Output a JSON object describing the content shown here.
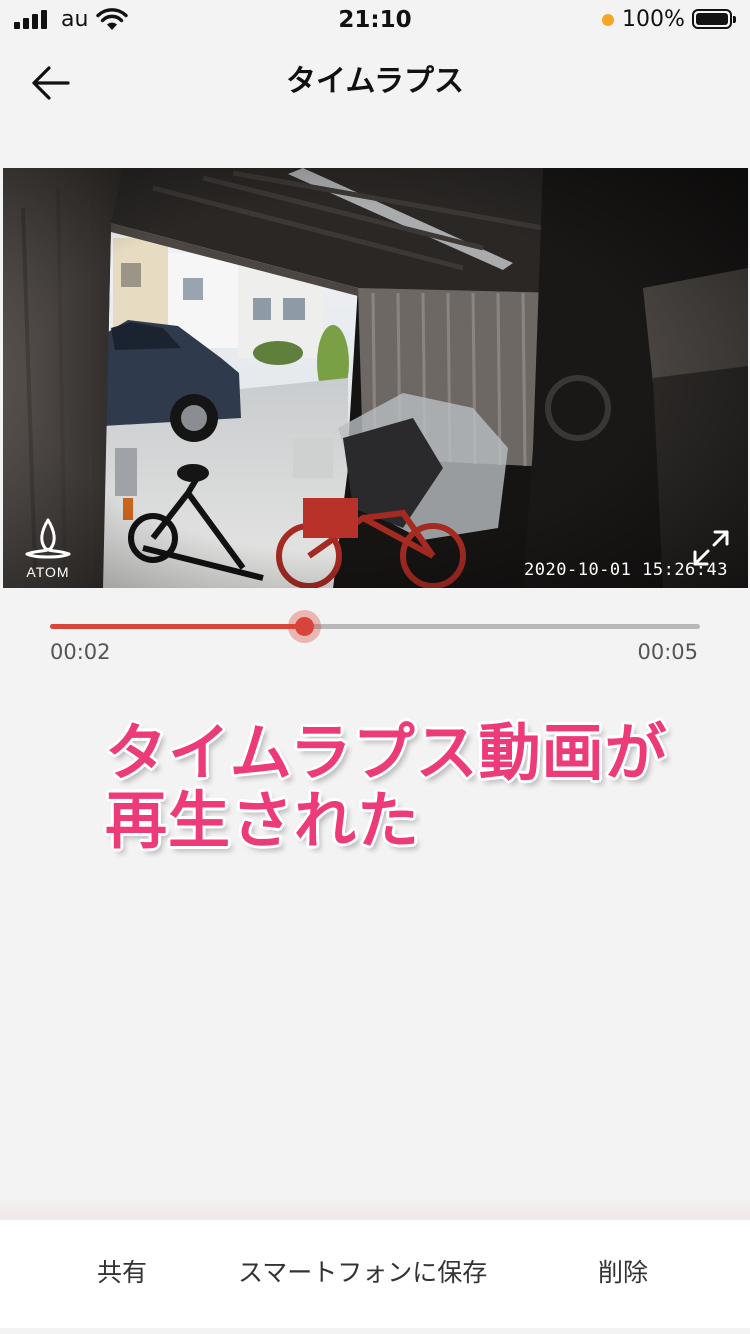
{
  "status_bar": {
    "carrier": "au",
    "time": "21:10",
    "battery_percent": "100%",
    "indicator_color": "#f5a623"
  },
  "nav": {
    "back_icon": "arrow-left-icon",
    "title": "タイムラプス"
  },
  "video": {
    "logo_text": "ATOM",
    "timestamp": "2020-10-01  15:26:43",
    "fullscreen_icon": "expand-icon"
  },
  "playback": {
    "current_time": "00:02",
    "total_time": "00:05",
    "progress": 0.39,
    "accent_color": "#d8443a"
  },
  "caption": {
    "line1": "タイムラプス動画が",
    "line2": "再生された",
    "color": "#ec3b78"
  },
  "actions": {
    "share": "共有",
    "save": "スマートフォンに保存",
    "delete": "削除"
  }
}
